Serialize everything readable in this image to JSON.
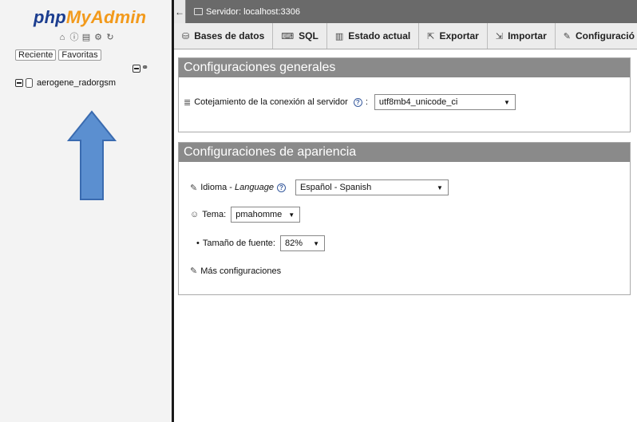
{
  "nav": {
    "logo_part1": "php",
    "logo_part2": "MyAdmin",
    "icons": [
      "home-icon",
      "info-icon",
      "docs-icon",
      "settings-icon",
      "reload-icon"
    ],
    "tab_recent": "Reciente",
    "tab_favorites": "Favoritas",
    "database": "aerogene_radorgsm"
  },
  "topbar": {
    "back_arrow": "←",
    "server_label": "Servidor: localhost:3306"
  },
  "menu": [
    {
      "icon": "⛁",
      "label": "Bases de datos"
    },
    {
      "icon": "⌨",
      "label": "SQL"
    },
    {
      "icon": "▥",
      "label": "Estado actual"
    },
    {
      "icon": "⇱",
      "label": "Exportar"
    },
    {
      "icon": "⇲",
      "label": "Importar"
    },
    {
      "icon": "✎",
      "label": "Configuració"
    }
  ],
  "general": {
    "title": "Configuraciones generales",
    "collation_label": "Cotejamiento de la conexión al servidor",
    "collation_suffix": ":",
    "collation_value": "utf8mb4_unicode_ci"
  },
  "appearance": {
    "title": "Configuraciones de apariencia",
    "language_label": "Idioma - ",
    "language_label_italic": "Language",
    "language_value": "Español - Spanish",
    "theme_label": "Tema:",
    "theme_value": "pmahomme",
    "font_size_label": "Tamaño de fuente:",
    "font_size_value": "82%",
    "more_settings": "Más configuraciones"
  },
  "colors": {
    "arrow_fill": "#5b8fd0",
    "arrow_stroke": "#3a6bb0",
    "header_bg": "#8a8a8a",
    "logo_blue": "#1b3d8f",
    "logo_orange": "#f29a1c"
  }
}
